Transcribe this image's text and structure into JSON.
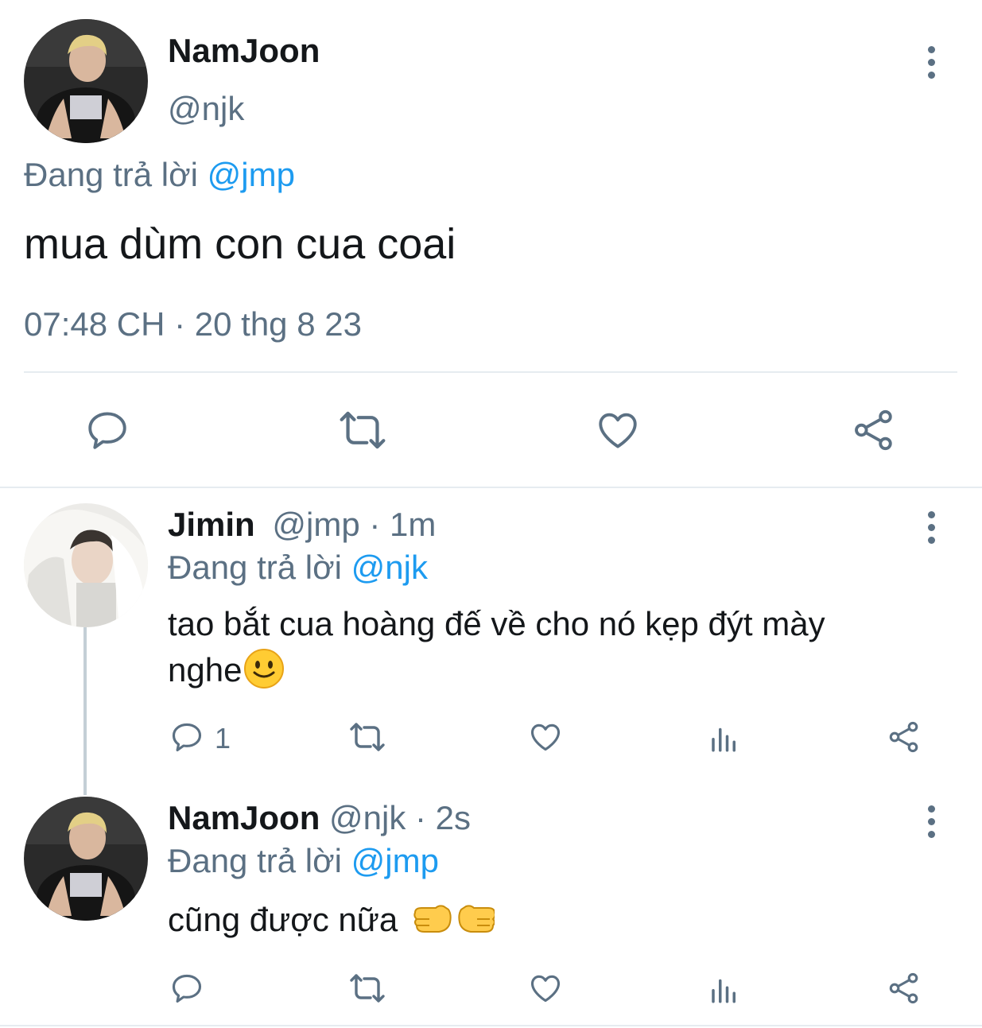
{
  "main_tweet": {
    "author_name": "NamJoon",
    "handle": "@njk",
    "replying_prefix": "Đang trả lời",
    "replying_to": "@jmp",
    "text": "mua dùm con cua coai",
    "timestamp": "07:48 CH · 20 thg 8 23",
    "actions": [
      "reply-icon",
      "retweet-icon",
      "like-icon",
      "share-icon"
    ]
  },
  "replies": [
    {
      "author_name": "Jimin",
      "handle_time": "@jmp · 1m",
      "replying_prefix": "Đang trả lời",
      "replying_to": "@njk",
      "text_line1": "tao bắt cua hoàng đế về cho nó kẹp đýt mày",
      "text_line2": "nghe",
      "emoji": "🙂",
      "reply_count": "1"
    },
    {
      "author_name": "NamJoon",
      "handle_time": "@njk · 2s",
      "replying_prefix": "Đang trả lời",
      "replying_to": "@jmp",
      "text": "cũng được nữa",
      "emoji": "👉👉"
    }
  ],
  "colors": {
    "text": "#14171a",
    "secondary": "#5b7083",
    "link": "#1d9bf0",
    "divider": "#e6ecf0"
  }
}
